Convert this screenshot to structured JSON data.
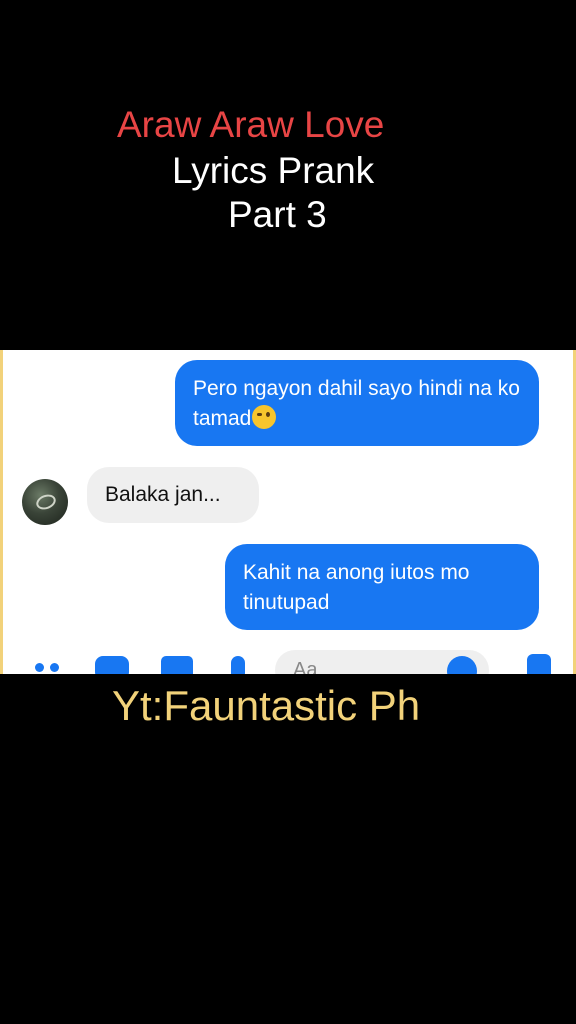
{
  "overlay": {
    "title_line1": "Araw Araw Love",
    "title_line2": "Lyrics Prank",
    "title_line3": "Part 3",
    "credit": "Yt:Fauntastic Ph"
  },
  "chat": {
    "messages": [
      {
        "direction": "sent",
        "text": "Pero ngayon dahil sayo hindi na ko tamad",
        "emoji": "winking-face"
      },
      {
        "direction": "received",
        "text": "Balaka jan..."
      },
      {
        "direction": "sent",
        "text": "Kahit na anong iutos mo tinutupad"
      }
    ],
    "composer": {
      "placeholder": "Aa",
      "icons": [
        "menu-dots-icon",
        "camera-icon",
        "image-icon",
        "mic-icon",
        "emoji-icon",
        "thumbs-up-icon"
      ]
    }
  },
  "colors": {
    "title_red": "#e84545",
    "sent_bubble": "#1877f2",
    "received_bubble": "#efefef",
    "credit_yellow": "#f2d27a"
  }
}
